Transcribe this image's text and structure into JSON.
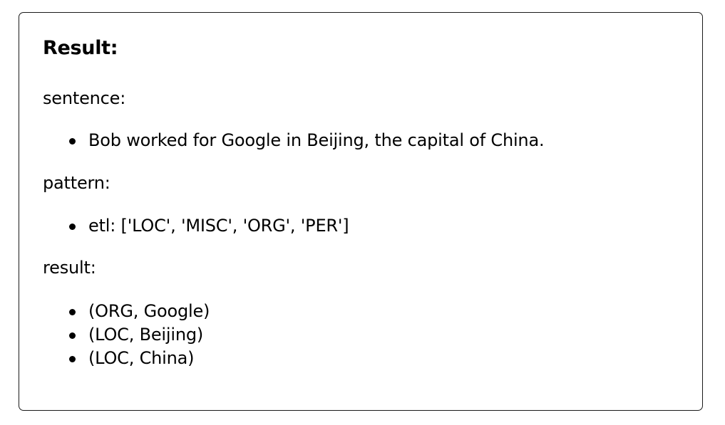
{
  "result_panel": {
    "title": "Result:",
    "sentence": {
      "label": "sentence:",
      "items": [
        "Bob worked for Google in Beijing, the capital of China."
      ]
    },
    "pattern": {
      "label": "pattern:",
      "items": [
        "etl: ['LOC', 'MISC', 'ORG', 'PER']"
      ]
    },
    "result": {
      "label": "result:",
      "items": [
        "(ORG, Google)",
        "(LOC, Beijing)",
        "(LOC, China)"
      ]
    }
  },
  "colors": {
    "border": "#1a1a1a",
    "text": "#000000",
    "background": "#ffffff"
  }
}
